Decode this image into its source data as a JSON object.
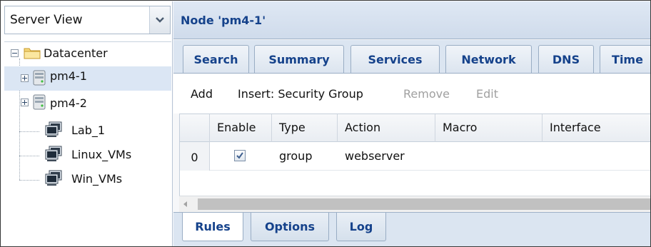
{
  "view_select": {
    "value": "Server View"
  },
  "tree": {
    "items": [
      {
        "label": "Datacenter",
        "icon": "folder-icon"
      },
      {
        "label": "pm4-1",
        "icon": "server-node-icon"
      },
      {
        "label": "pm4-2",
        "icon": "server-node-icon"
      },
      {
        "label": "Lab_1",
        "icon": "pool-icon"
      },
      {
        "label": "Linux_VMs",
        "icon": "pool-icon"
      },
      {
        "label": "Win_VMs",
        "icon": "pool-icon"
      }
    ]
  },
  "panel": {
    "title": "Node 'pm4-1'"
  },
  "tabs": [
    "Search",
    "Summary",
    "Services",
    "Network",
    "DNS",
    "Time"
  ],
  "toolbar": {
    "add": "Add",
    "insert": "Insert: Security Group",
    "remove": "Remove",
    "edit": "Edit"
  },
  "grid": {
    "columns": [
      "Enable",
      "Type",
      "Action",
      "Macro",
      "Interface"
    ],
    "rows": [
      {
        "num": "0",
        "enable": true,
        "type": "group",
        "action": "webserver",
        "macro": "",
        "interface": ""
      }
    ]
  },
  "bottom_tabs": [
    "Rules",
    "Options",
    "Log"
  ],
  "colors": {
    "accent": "#15428b",
    "header_bg": "#dbe5f1",
    "selection": "#dbe6f4"
  }
}
